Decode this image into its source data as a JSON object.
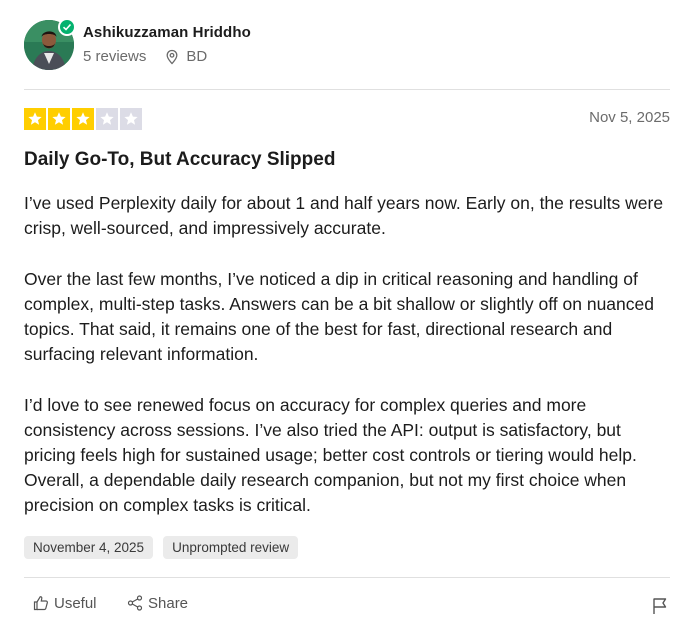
{
  "reviewer": {
    "name": "Ashikuzzaman Hriddho",
    "reviews_count": "5 reviews",
    "location": "BD",
    "verified": true
  },
  "review": {
    "rating": 3,
    "max_rating": 5,
    "date": "Nov 5, 2025",
    "title": "Daily Go-To, But Accuracy Slipped",
    "paragraphs": [
      "I’ve used Perplexity daily for about 1 and half years now. Early on, the results were crisp, well-sourced, and impressively accurate.",
      "Over the last few months, I’ve noticed a dip in critical reasoning and handling of complex, multi-step tasks. Answers can be a bit shallow or slightly off on nuanced topics. That said, it remains one of the best for fast, directional research and surfacing relevant information.",
      "I’d love to see renewed focus on accuracy for complex queries and more consistency across sessions. I’ve also tried the API: output is satisfactory, but pricing feels high for sustained usage; better cost controls or tiering would help. Overall, a dependable daily research companion, but not my first choice when precision on complex tasks is critical."
    ],
    "tags": [
      "November 4, 2025",
      "Unprompted review"
    ]
  },
  "actions": {
    "useful_label": "Useful",
    "share_label": "Share"
  },
  "colors": {
    "star_on": "#ffce00",
    "star_off": "#dcdce6",
    "verified": "#04b26f",
    "tag_bg": "#ebebeb"
  },
  "icons": [
    "verified-check-icon",
    "location-pin-icon",
    "star-icon",
    "thumbs-up-icon",
    "share-icon",
    "flag-icon"
  ]
}
